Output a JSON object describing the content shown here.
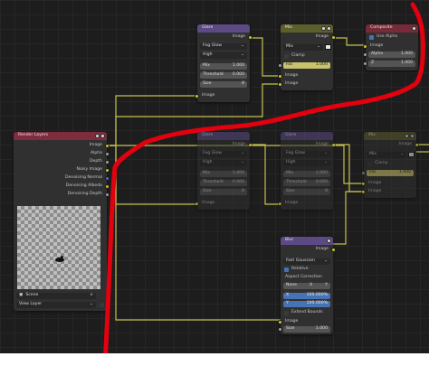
{
  "colors": {
    "canvas": "#1d1d1d",
    "node_body": "#303030",
    "filter_header": "#5b4a84",
    "color_header": "#5c5e2c",
    "output_header": "#772a37",
    "input_header": "#7f2c3e",
    "socket_color": "#c7c729",
    "socket_gray": "#a1a1a1",
    "wire": "#d8d055",
    "annotation": "#e3000f"
  },
  "glare_top": {
    "title": "Glare",
    "output": "Image",
    "type_value": "Fog Glow",
    "quality_value": "High",
    "mix_label": "Mix",
    "mix_value": "1.000",
    "threshold_label": "Threshold",
    "threshold_value": "0.000",
    "size_label": "Size",
    "size_value": "8",
    "input": "Image"
  },
  "mix_top": {
    "title": "Mix",
    "output": "Image",
    "blend_value": "Mix",
    "clamp_label": "Clamp",
    "fac_label": "Fac",
    "fac_value": "1.000",
    "input_a": "Image",
    "input_b": "Image"
  },
  "composite": {
    "title": "Composite",
    "use_alpha_label": "Use Alpha",
    "input_image": "Image",
    "alpha_label": "Alpha",
    "alpha_value": "1.000",
    "z_label": "Z",
    "z_value": "1.000"
  },
  "render_layers": {
    "title": "Render Layers",
    "outputs": [
      "Image",
      "Alpha",
      "Depth",
      "Noisy Image",
      "Denoising Normal",
      "Denoising Albedo",
      "Denoising Depth"
    ],
    "scene_value": "Scene",
    "layer_value": "View Layer"
  },
  "glare_mid": {
    "title": "Glare",
    "output": "Image",
    "type_value": "Fog Glow",
    "quality_value": "High",
    "mix_label": "Mix",
    "mix_value": "1.000",
    "threshold_label": "Threshold",
    "threshold_value": "0.000",
    "size_label": "Size",
    "size_value": "8",
    "input": "Image"
  },
  "glare_mid2": {
    "title": "Glare",
    "output": "Image",
    "type_value": "Fog Glow",
    "quality_value": "High",
    "mix_label": "Mix",
    "mix_value": "1.000",
    "threshold_label": "Threshold",
    "threshold_value": "0.000",
    "size_label": "Size",
    "size_value": "8",
    "input": "Image"
  },
  "mix_mid": {
    "title": "Mix",
    "output": "Image",
    "blend_value": "Mix",
    "clamp_label": "Clamp",
    "fac_label": "Fac",
    "fac_value": "1.000",
    "input_a": "Image",
    "input_b": "Image"
  },
  "blur": {
    "title": "Blur",
    "output": "Image",
    "type_value": "Fast Gaussian",
    "relative_label": "Relative",
    "aspect_label": "Aspect Correction",
    "aspect_value": "None",
    "x_label": "X",
    "x_value": "100.000%",
    "y_label": "Y",
    "y_value": "100.000%",
    "extend_label": "Extend Bounds",
    "input": "Image",
    "size_label": "Size",
    "size_value": "1.000"
  }
}
